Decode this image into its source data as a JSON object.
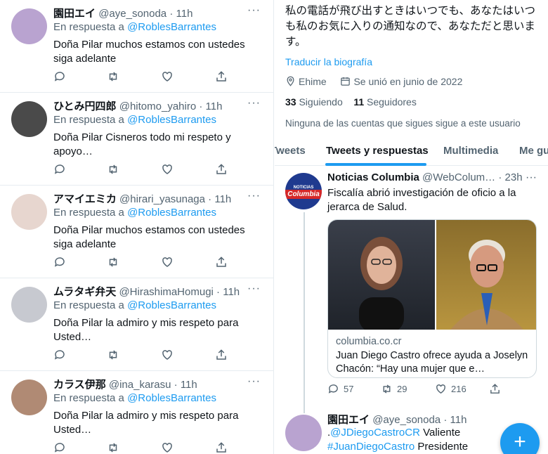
{
  "left_replies": [
    {
      "name": "園田エイ",
      "handle": "@aye_sonoda",
      "time": "11h",
      "in_reply_prefix": "En respuesta a",
      "mention": "@RoblesBarrantes",
      "text": "Doña Pilar muchos estamos con ustedes siga adelante",
      "avatar_color": "#b9a3d0"
    },
    {
      "name": "ひとみ円四郎",
      "handle": "@hitomo_yahiro",
      "time": "11h",
      "in_reply_prefix": "En respuesta a",
      "mention": "@RoblesBarrantes",
      "text": "Doña Pilar Cisneros todo mi respeto y apoyo…",
      "avatar_color": "#4a4a4a"
    },
    {
      "name": "アマイエミカ",
      "handle": "@hirari_yasunaga",
      "time": "11h",
      "in_reply_prefix": "En respuesta a",
      "mention": "@RoblesBarrantes",
      "text": "Doña Pilar muchos estamos con ustedes siga adelante",
      "avatar_color": "#e7d6cf"
    },
    {
      "name": "ムラタギ弁天",
      "handle": "@HirashimaHomugi",
      "time": "11h",
      "in_reply_prefix": "En respuesta a",
      "mention": "@RoblesBarrantes",
      "text": "Doña Pilar la admiro y mis respeto para Usted…",
      "avatar_color": "#c7c9d0"
    },
    {
      "name": "カラス伊那",
      "handle": "@ina_karasu",
      "time": "11h",
      "in_reply_prefix": "En respuesta a",
      "mention": "@RoblesBarrantes",
      "text": "Doña Pilar la admiro y mis respeto para Usted…",
      "avatar_color": "#b08a74"
    }
  ],
  "profile": {
    "bio": "私の電話が飛び出すときはいつでも、あなたはいつも私のお気に入りの通知なので、あなただと思います。",
    "translate_label": "Traducir la biografía",
    "location": "Ehime",
    "joined": "Se unió en junio de 2022",
    "following_count": "33",
    "following_label": "Siguiendo",
    "followers_count": "11",
    "followers_label": "Seguidores",
    "no_known_followers": "Ninguna de las cuentas que sigues sigue a este usuario"
  },
  "tabs": [
    {
      "label": "Tweets",
      "active": false
    },
    {
      "label": "Tweets y respuestas",
      "active": true
    },
    {
      "label": "Multimedia",
      "active": false
    },
    {
      "label": "Me gu",
      "active": false
    }
  ],
  "tweet": {
    "name": "Noticias Columbia",
    "handle": "@WebColum…",
    "time": "23h",
    "text": "Fiscalía abrió investigación de oficio a la jerarca de Salud.",
    "avatar_text_top": "NOTICIAS",
    "avatar_text_main": "Columbia",
    "card": {
      "domain": "columbia.co.cr",
      "title": "Juan Diego Castro ofrece ayuda a Joselyn Chacón: “Hay una mujer que e…"
    },
    "replies": "57",
    "retweets": "29",
    "likes": "216"
  },
  "reply_tweet": {
    "name": "園田エイ",
    "handle": "@aye_sonoda",
    "time": "11h",
    "prefix_dot": ".",
    "mention": "@JDiegoCastroCR",
    "after_mention": " Valiente",
    "hashtag": "#JuanDiegoCastro",
    "after_hashtag": " Presidente",
    "avatar_color": "#b9a3d0"
  },
  "fab_label": "+",
  "colors": {
    "accent": "#1d9bf0",
    "text": "#0f1419",
    "muted": "#536471",
    "border": "#e6ecf0"
  },
  "icons": [
    "reply-icon",
    "retweet-icon",
    "like-icon",
    "share-icon",
    "more-icon",
    "location-icon",
    "calendar-icon",
    "compose-icon"
  ]
}
